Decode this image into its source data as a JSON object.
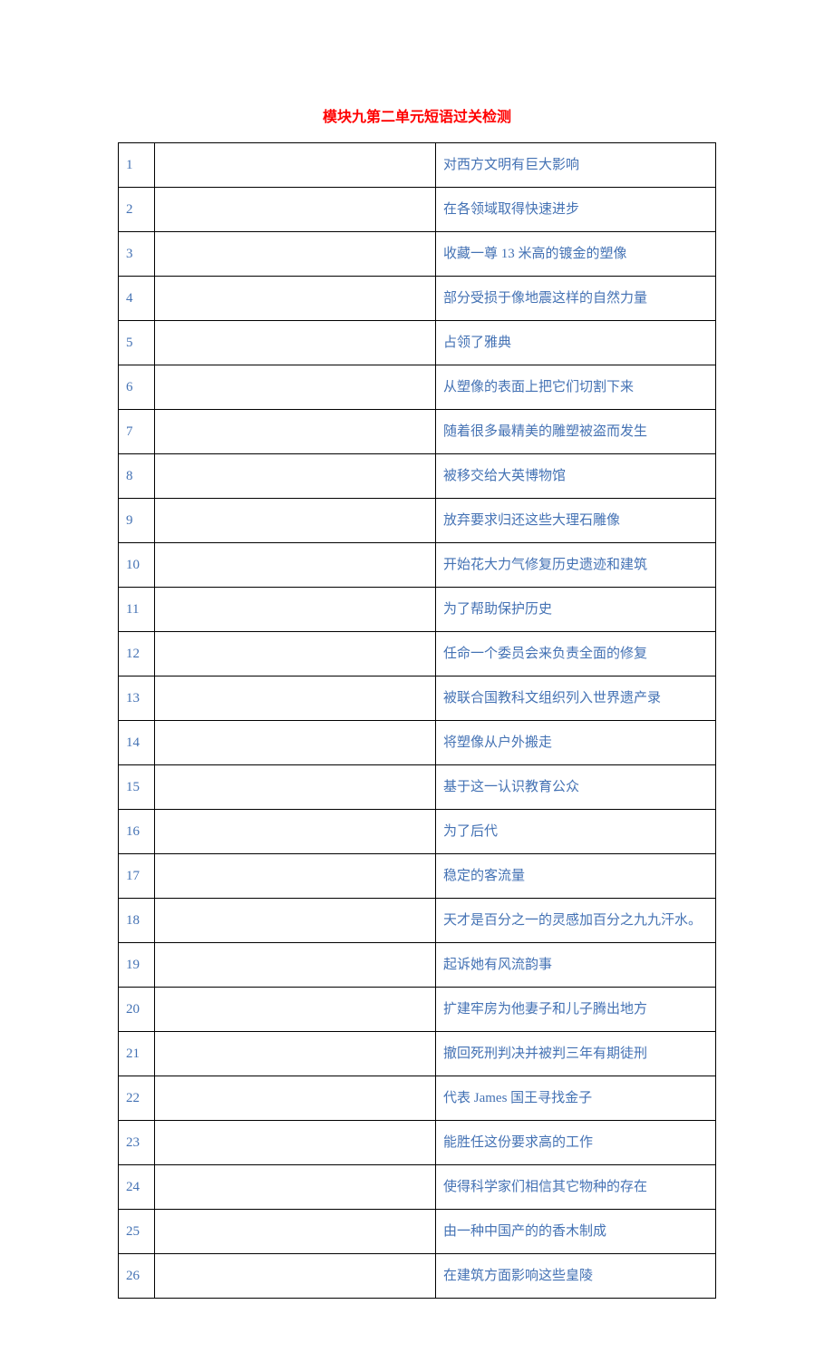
{
  "title": "模块九第二单元短语过关检测",
  "rows": [
    {
      "num": "1",
      "desc": "对西方文明有巨大影响"
    },
    {
      "num": "2",
      "desc": "在各领域取得快速进步"
    },
    {
      "num": "3",
      "desc": "收藏一尊 13 米高的镀金的塑像"
    },
    {
      "num": "4",
      "desc": "部分受损于像地震这样的自然力量"
    },
    {
      "num": "5",
      "desc": "占领了雅典"
    },
    {
      "num": "6",
      "desc": "从塑像的表面上把它们切割下来"
    },
    {
      "num": "7",
      "desc": "随着很多最精美的雕塑被盗而发生"
    },
    {
      "num": "8",
      "desc": "被移交给大英博物馆"
    },
    {
      "num": "9",
      "desc": "放弃要求归还这些大理石雕像"
    },
    {
      "num": "10",
      "desc": "开始花大力气修复历史遗迹和建筑"
    },
    {
      "num": "11",
      "desc": "为了帮助保护历史"
    },
    {
      "num": "12",
      "desc": "任命一个委员会来负责全面的修复"
    },
    {
      "num": "13",
      "desc": "被联合国教科文组织列入世界遗产录"
    },
    {
      "num": "14",
      "desc": "将塑像从户外搬走"
    },
    {
      "num": "15",
      "desc": "基于这一认识教育公众"
    },
    {
      "num": "16",
      "desc": "为了后代"
    },
    {
      "num": "17",
      "desc": "稳定的客流量"
    },
    {
      "num": "18",
      "desc": "天才是百分之一的灵感加百分之九九汗水。"
    },
    {
      "num": "19",
      "desc": "起诉她有风流韵事"
    },
    {
      "num": "20",
      "desc": "扩建牢房为他妻子和儿子腾出地方"
    },
    {
      "num": "21",
      "desc": "撤回死刑判决并被判三年有期徒刑"
    },
    {
      "num": "22",
      "desc": "代表 James 国王寻找金子"
    },
    {
      "num": "23",
      "desc": "能胜任这份要求高的工作"
    },
    {
      "num": "24",
      "desc": "使得科学家们相信其它物种的存在"
    },
    {
      "num": "25",
      "desc": "由一种中国产的的香木制成"
    },
    {
      "num": "26",
      "desc": "在建筑方面影响这些皇陵"
    }
  ]
}
